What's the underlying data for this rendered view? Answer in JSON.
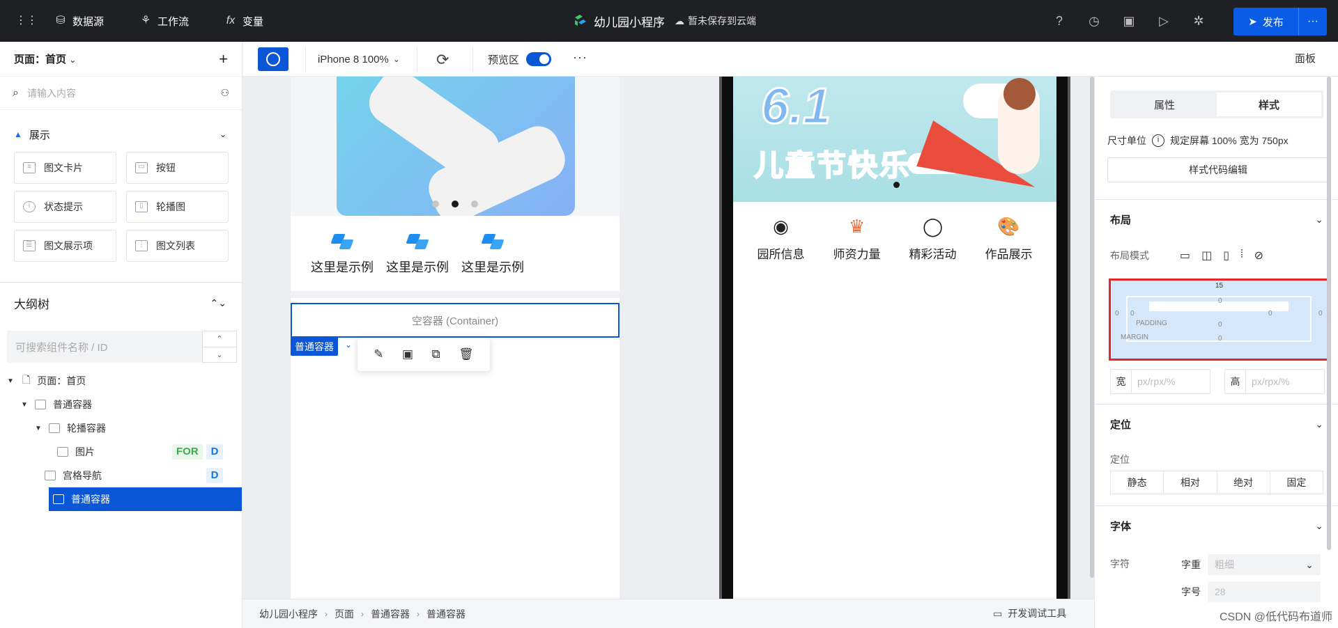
{
  "topbar": {
    "datasource": "数据源",
    "workflow": "工作流",
    "variables": "变量",
    "app_title": "幼儿园小程序",
    "save_status": "暂未保存到云端",
    "publish": "发布"
  },
  "left": {
    "page_header": "页面：首页",
    "search_placeholder": "请输入内容",
    "section_display": "展示",
    "components": [
      {
        "label": "图文卡片"
      },
      {
        "label": "按钮"
      },
      {
        "label": "状态提示"
      },
      {
        "label": "轮播图"
      },
      {
        "label": "图文展示项"
      },
      {
        "label": "图文列表"
      }
    ],
    "outline_title": "大纲树",
    "outline_search_placeholder": "可搜索组件名称 / ID",
    "tree": [
      {
        "label": "页面：首页"
      },
      {
        "label": "普通容器"
      },
      {
        "label": "轮播容器"
      },
      {
        "label": "图片",
        "tag1": "FOR",
        "tag2": "D"
      },
      {
        "label": "宫格导航",
        "tag2": "D"
      },
      {
        "label": "普通容器"
      }
    ]
  },
  "toolbar2": {
    "device": "iPhone 8 100%",
    "preview_label": "预览区",
    "panel_label": "面板"
  },
  "editor": {
    "grid_items": [
      "这里是示例",
      "这里是示例",
      "这里是示例"
    ],
    "container_label": "空容器 (Container)",
    "selected_tag": "普通容器"
  },
  "phone": {
    "banner_big": "6.1",
    "banner_title": [
      "儿",
      "童",
      "节",
      "快",
      "乐"
    ],
    "nav": [
      {
        "label": "园所信息",
        "icon": "kindergarten-icon"
      },
      {
        "label": "师资力量",
        "icon": "teachers-icon"
      },
      {
        "label": "精彩活动",
        "icon": "balloon-icon"
      },
      {
        "label": "作品展示",
        "icon": "palette-icon"
      }
    ]
  },
  "breadcrumb": [
    "幼儿园小程序",
    "页面",
    "普通容器",
    "普通容器"
  ],
  "devtools": "开发调试工具",
  "right": {
    "tab_props": "属性",
    "tab_style": "样式",
    "unit_label": "尺寸单位",
    "unit_value": "规定屏幕 100% 宽为 750px",
    "code_btn": "样式代码编辑",
    "layout_title": "布局",
    "layout_mode": "布局模式",
    "boxmodel": {
      "top": "15",
      "padding_label": "PADDING",
      "margin_label": "MARGIN",
      "zero": "0"
    },
    "width_key": "宽",
    "height_key": "高",
    "size_placeholder": "px/rpx/%",
    "position_title": "定位",
    "position_label": "定位",
    "position_options": [
      "静态",
      "相对",
      "绝对",
      "固定"
    ],
    "font_title": "字体",
    "font_label": "字符",
    "font_weight_key": "字重",
    "font_weight_val": "粗细",
    "font_size_key": "字号",
    "font_size_val": "28"
  },
  "watermark": "CSDN @低代码布道师",
  "colors": {
    "accent": "#0a56d6",
    "topbar": "#1f2024",
    "highlight": "#e3282c"
  }
}
